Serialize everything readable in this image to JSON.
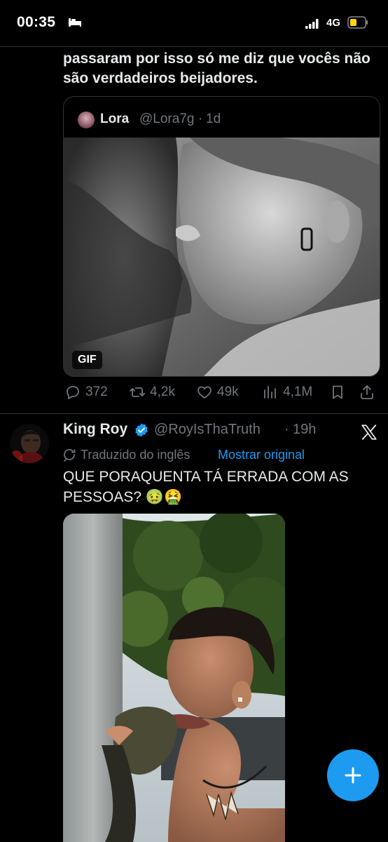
{
  "status_bar": {
    "time": "00:35",
    "network": "4G"
  },
  "previous_tweet": {
    "text": "passaram por isso só me diz que vocês não são verdadeiros beijadores."
  },
  "quoted_tweet": {
    "name": "Lora",
    "handle": "@Lora7g",
    "separator": "·",
    "time": "1d",
    "media_badge": "GIF"
  },
  "actions": {
    "replies": "372",
    "retweets": "4,2k",
    "likes": "49k",
    "views": "4,1M"
  },
  "tweet": {
    "name": "King Roy",
    "handle": "@RoyIsThaTruth",
    "separator": "·",
    "time": "19h",
    "translated_label": "Traduzido do inglês",
    "show_original": "Mostrar original",
    "text": "QUE PORAQUENTA TÁ ERRADA COM AS PESSOAS? 🤢🤮"
  },
  "colors": {
    "accent": "#1d9bf0",
    "muted": "#71767b",
    "text": "#e7e9ea",
    "background": "#000000"
  }
}
